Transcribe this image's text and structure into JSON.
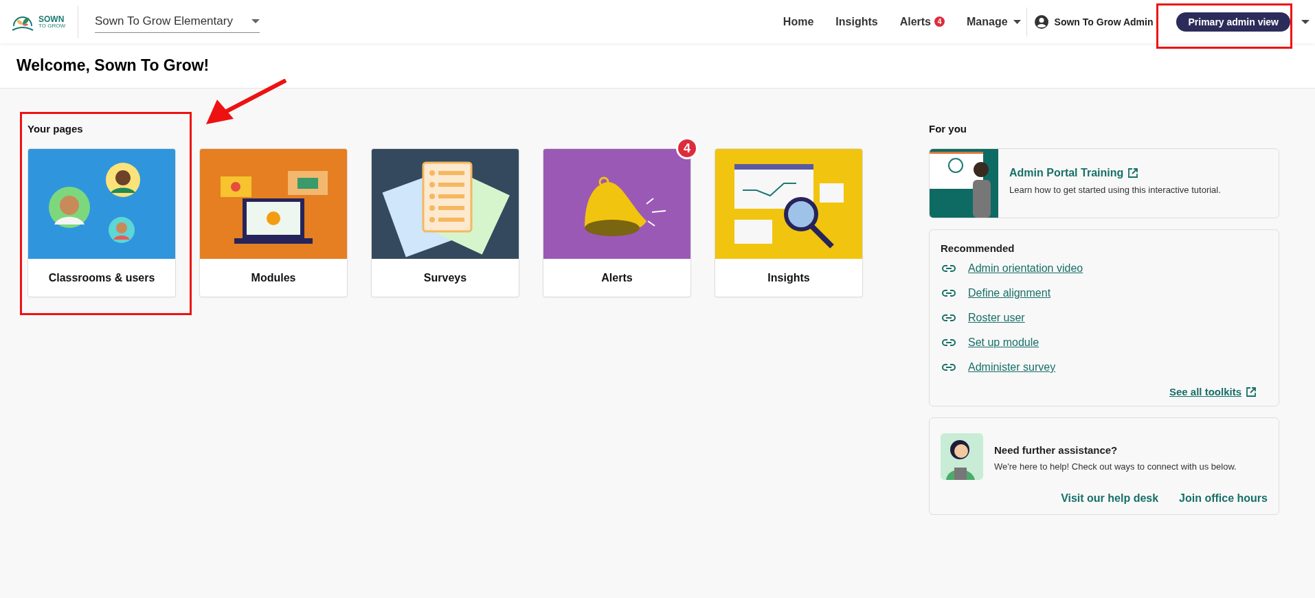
{
  "header": {
    "logo": {
      "line_1": "SOWN",
      "line_2": "TO GROW"
    },
    "school_select": {
      "value": "Sown To Grow Elementary"
    },
    "nav": [
      {
        "label": "Home",
        "kind": "link"
      },
      {
        "label": "Insights",
        "kind": "link"
      },
      {
        "label": "Alerts",
        "kind": "badge",
        "badge": "4"
      },
      {
        "label": "Manage",
        "kind": "menu"
      }
    ],
    "user": "Sown To Grow Admin",
    "view_button": "Primary admin view"
  },
  "welcome": "Welcome, Sown To Grow!",
  "your_pages": {
    "title": "Your pages",
    "cards": [
      {
        "label": "Classrooms & users",
        "kind": "people"
      },
      {
        "label": "Modules",
        "kind": "laptop"
      },
      {
        "label": "Surveys",
        "kind": "papers"
      },
      {
        "label": "Alerts",
        "kind": "bell",
        "badge": "4"
      },
      {
        "label": "Insights",
        "kind": "chart"
      }
    ]
  },
  "for_you": {
    "title": "For you",
    "training": {
      "title": "Admin Portal Training",
      "text": "Learn how to get started using this interactive tutorial."
    },
    "recommended": {
      "title": "Recommended",
      "links": [
        "Admin orientation video",
        "Define alignment",
        "Roster user",
        "Set up module",
        "Administer survey"
      ],
      "see_all": "See all toolkits"
    },
    "help": {
      "title": "Need further assistance?",
      "text": "We're here to help! Check out ways to connect with us below.",
      "links": [
        "Visit our help desk",
        "Join office hours"
      ]
    }
  }
}
